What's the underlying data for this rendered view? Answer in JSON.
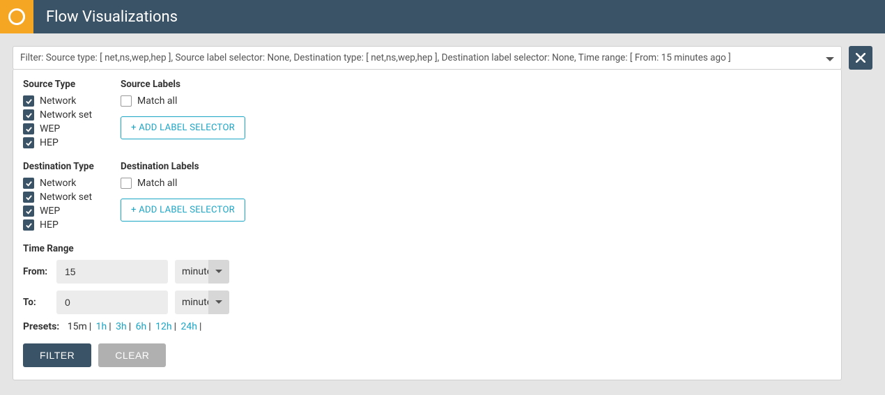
{
  "header": {
    "title": "Flow Visualizations"
  },
  "filter_bar": "Filter: Source type: [ net,ns,wep,hep ], Source label selector: None, Destination type: [ net,ns,wep,hep ], Destination label selector: None, Time range: [ From: 15 minutes ago ]",
  "source_type": {
    "title": "Source Type",
    "items": [
      "Network",
      "Network set",
      "WEP",
      "HEP"
    ]
  },
  "source_labels": {
    "title": "Source Labels",
    "match_all": "Match all",
    "add_btn": "+ ADD LABEL SELECTOR"
  },
  "dest_type": {
    "title": "Destination Type",
    "items": [
      "Network",
      "Network set",
      "WEP",
      "HEP"
    ]
  },
  "dest_labels": {
    "title": "Destination Labels",
    "match_all": "Match all",
    "add_btn": "+ ADD LABEL SELECTOR"
  },
  "time": {
    "title": "Time Range",
    "from_label": "From:",
    "from_value": "15",
    "from_unit": "minute",
    "to_label": "To:",
    "to_value": "0",
    "to_unit": "minutes"
  },
  "presets": {
    "label": "Presets:",
    "active": "15m",
    "items": [
      "1h",
      "3h",
      "6h",
      "12h",
      "24h"
    ]
  },
  "buttons": {
    "filter": "FILTER",
    "clear": "CLEAR"
  }
}
